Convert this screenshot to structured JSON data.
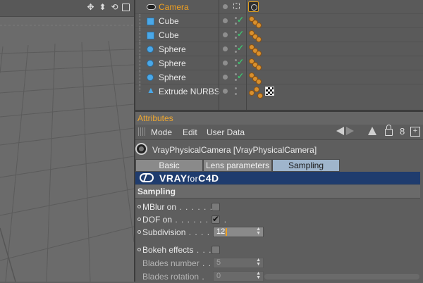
{
  "viewport": {
    "icons": [
      "move-icon",
      "arrow-down-icon",
      "rotate-icon",
      "maximize-icon"
    ],
    "icon_glyphs": [
      "✥",
      "⬍",
      "⟲",
      ""
    ]
  },
  "objects": [
    {
      "name": "Camera",
      "icon": "camera-icon",
      "active": true
    },
    {
      "name": "Cube",
      "icon": "cube-icon"
    },
    {
      "name": "Cube",
      "icon": "cube-icon"
    },
    {
      "name": "Sphere",
      "icon": "sphere-icon"
    },
    {
      "name": "Sphere",
      "icon": "sphere-icon"
    },
    {
      "name": "Sphere",
      "icon": "sphere-icon"
    },
    {
      "name": "Extrude NURBS",
      "icon": "extrude-icon"
    }
  ],
  "attributes": {
    "title": "Attributes",
    "menu": [
      "Mode",
      "Edit",
      "User Data"
    ],
    "object_title": "VrayPhysicalCamera [VrayPhysicalCamera]",
    "tabs": [
      "Basic",
      "Lens parameters",
      "Sampling"
    ],
    "active_tab": "Sampling",
    "banner": {
      "brand": "VRAY",
      "for": "for",
      "app": "C4D"
    },
    "section": "Sampling",
    "props": {
      "mblur": {
        "label": "MBlur on",
        "dots": " . . . . . . .",
        "checked": false
      },
      "dof": {
        "label": "DOF on",
        "dots": " . . . . . . . . .",
        "checked": true,
        "check_glyph": "✔"
      },
      "subdivision": {
        "label": "Subdivision",
        "dots": " . . . . .",
        "value": "12"
      },
      "bokeh": {
        "label": "Bokeh effects",
        "dots": " . . . .",
        "checked": false
      },
      "blades_number": {
        "label": "Blades number",
        "dots": " . .",
        "value": "5"
      },
      "blades_rotation": {
        "label": "Blades rotation",
        "dots": " .",
        "value": "0"
      }
    }
  },
  "colors": {
    "accent_orange": "#f0a020",
    "vray_banner": "#1f3c6e",
    "selected_tab": "#9fb5cc",
    "check_green": "#3fbf6f"
  }
}
